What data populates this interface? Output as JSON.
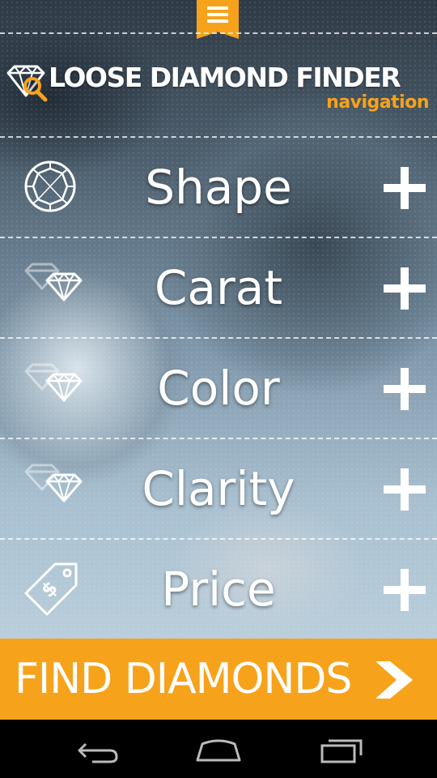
{
  "header": {
    "menu_icon": "hamburger-menu-icon",
    "logo_icon": "diamond-magnifier-icon",
    "title": "LOOSE DIAMOND FINDER",
    "subtitle": "navigation"
  },
  "nav": {
    "items": [
      {
        "label": "Shape",
        "icon": "round-diamond-icon"
      },
      {
        "label": "Carat",
        "icon": "diamond-stack-icon"
      },
      {
        "label": "Color",
        "icon": "diamond-stack-icon"
      },
      {
        "label": "Clarity",
        "icon": "diamond-stack-icon"
      },
      {
        "label": "Price",
        "icon": "price-tag-icon"
      }
    ],
    "expand_icon": "plus-icon"
  },
  "cta": {
    "label": "FIND DIAMONDS",
    "icon": "chevron-right-icon"
  },
  "system_nav": {
    "back_icon": "back-icon",
    "home_icon": "home-icon",
    "recents_icon": "recent-apps-icon"
  },
  "colors": {
    "accent": "#f7a21b",
    "text": "#ffffff",
    "system_bar": "#000000"
  }
}
